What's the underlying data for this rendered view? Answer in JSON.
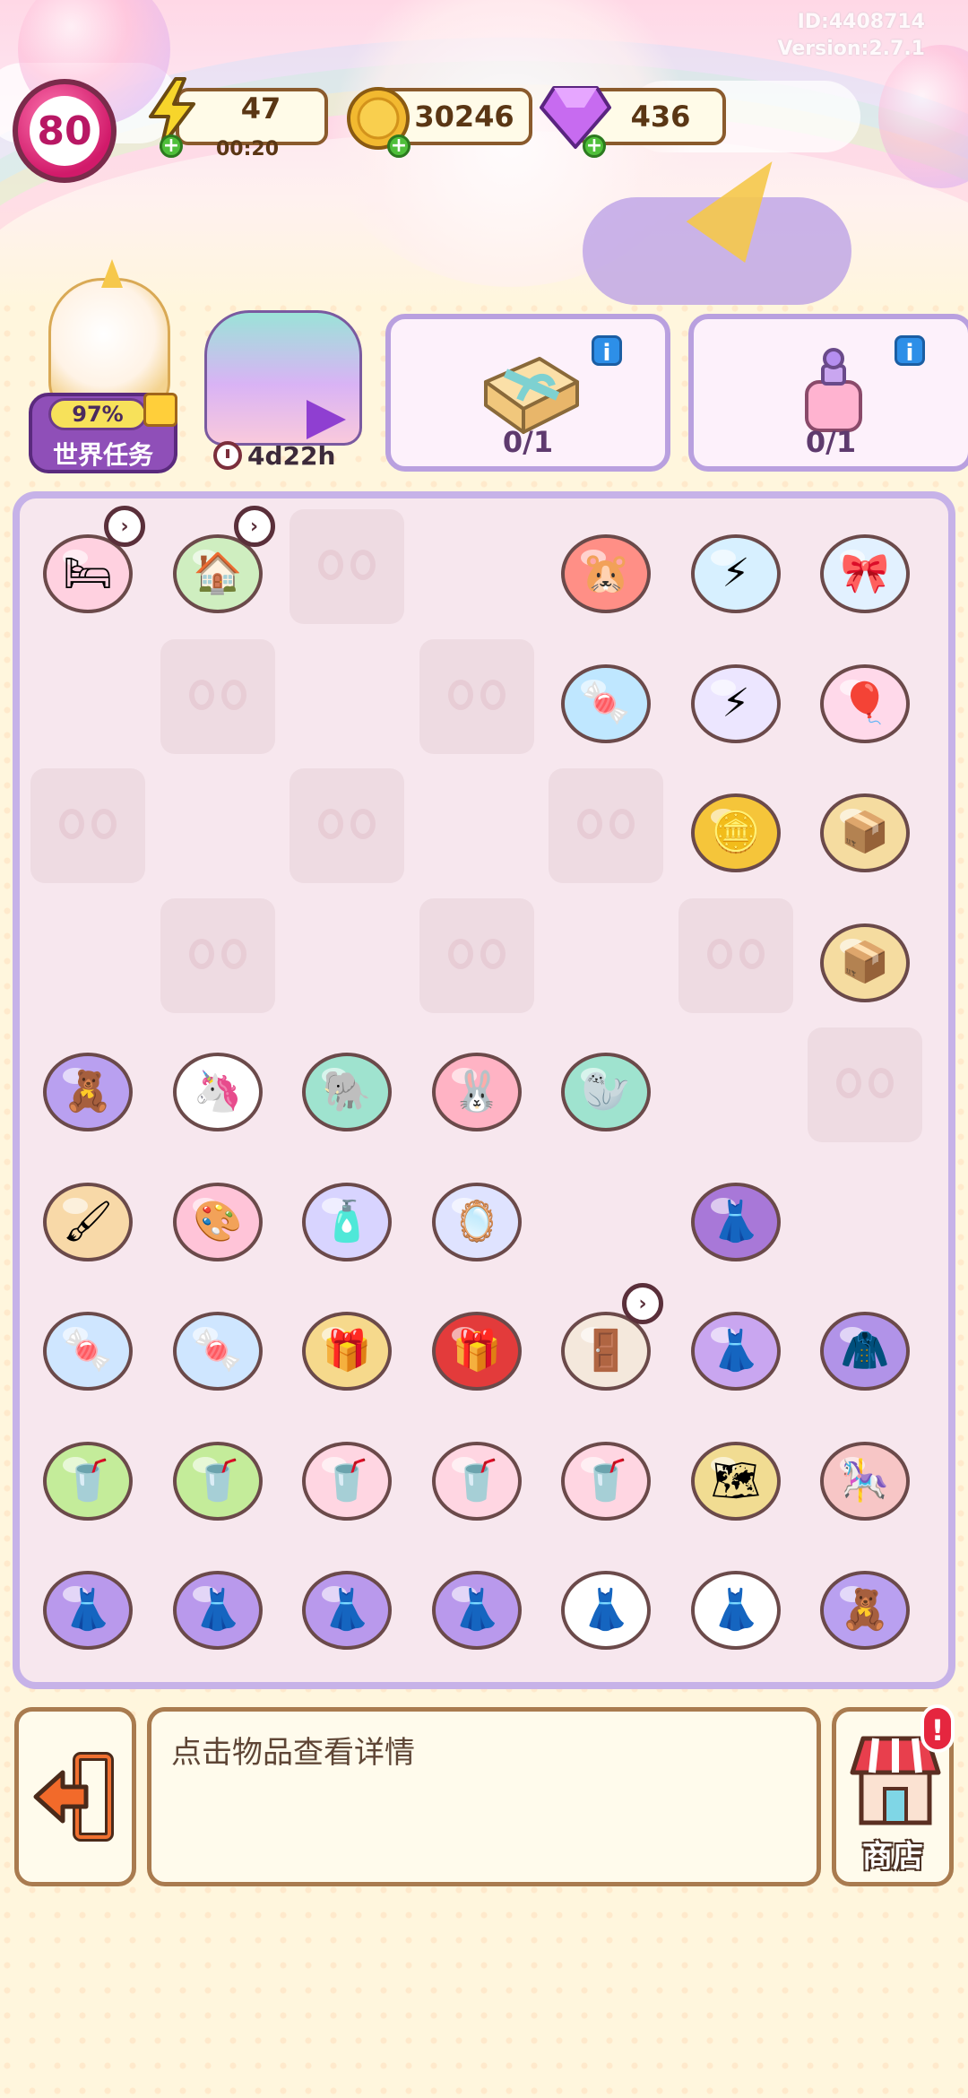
{
  "meta": {
    "id": "ID:4408714",
    "version": "Version:2.7.1"
  },
  "player": {
    "level": "80"
  },
  "resources": {
    "energy": {
      "value": "47",
      "timer": "00:20",
      "icon": "lightning-icon"
    },
    "coins": {
      "value": "30246",
      "icon": "coin-icon"
    },
    "gems": {
      "value": "436",
      "icon": "gem-icon"
    }
  },
  "world_task": {
    "percent": "97%",
    "label": "世界任务"
  },
  "event": {
    "timer": "4d22h"
  },
  "orders": [
    {
      "item": "gift-box-icon",
      "count": "0/1"
    },
    {
      "item": "perfume-bottle-icon",
      "count": "0/1"
    }
  ],
  "board": {
    "columns": 7,
    "rows": 9,
    "cells": [
      {
        "r": 0,
        "c": 0,
        "state": "open",
        "item": "canopy-bed",
        "icon": "🛏",
        "bg": "#ffd1e0",
        "timer": true
      },
      {
        "r": 0,
        "c": 1,
        "state": "open",
        "item": "toy-house",
        "icon": "🏠",
        "bg": "#cfeec0",
        "timer": true
      },
      {
        "r": 0,
        "c": 2,
        "state": "locked"
      },
      {
        "r": 0,
        "c": 3,
        "state": "open",
        "item": "",
        "icon": ""
      },
      {
        "r": 0,
        "c": 4,
        "state": "open",
        "item": "hamster-plush",
        "icon": "🐹",
        "bg": "#ff8f86"
      },
      {
        "r": 0,
        "c": 5,
        "state": "open",
        "item": "energy-jar-small",
        "icon": "⚡",
        "bg": "#d7f0ff"
      },
      {
        "r": 0,
        "c": 6,
        "state": "open",
        "item": "bow-gift-jar",
        "icon": "🎀",
        "bg": "#e2f1ff"
      },
      {
        "r": 1,
        "c": 0,
        "state": "open",
        "item": "",
        "icon": ""
      },
      {
        "r": 1,
        "c": 1,
        "state": "locked"
      },
      {
        "r": 1,
        "c": 2,
        "state": "open",
        "item": "",
        "icon": ""
      },
      {
        "r": 1,
        "c": 3,
        "state": "locked"
      },
      {
        "r": 1,
        "c": 4,
        "state": "open",
        "item": "candy-tray",
        "icon": "🍬",
        "bg": "#bfe7ff"
      },
      {
        "r": 1,
        "c": 5,
        "state": "open",
        "item": "energy-jar-large",
        "icon": "⚡",
        "bg": "#ece6ff"
      },
      {
        "r": 1,
        "c": 6,
        "state": "open",
        "item": "balloon-gift",
        "icon": "🎈",
        "bg": "#ffd9ea"
      },
      {
        "r": 2,
        "c": 0,
        "state": "locked"
      },
      {
        "r": 2,
        "c": 1,
        "state": "open",
        "item": "",
        "icon": ""
      },
      {
        "r": 2,
        "c": 2,
        "state": "locked"
      },
      {
        "r": 2,
        "c": 3,
        "state": "open",
        "item": "",
        "icon": ""
      },
      {
        "r": 2,
        "c": 4,
        "state": "locked"
      },
      {
        "r": 2,
        "c": 5,
        "state": "open",
        "item": "gold-coin",
        "icon": "🪙",
        "bg": "#f5c53a"
      },
      {
        "r": 2,
        "c": 6,
        "state": "open",
        "item": "open-box-large",
        "icon": "📦",
        "bg": "#f5dca0"
      },
      {
        "r": 3,
        "c": 0,
        "state": "open",
        "item": "",
        "icon": ""
      },
      {
        "r": 3,
        "c": 1,
        "state": "locked"
      },
      {
        "r": 3,
        "c": 2,
        "state": "open",
        "item": "",
        "icon": ""
      },
      {
        "r": 3,
        "c": 3,
        "state": "locked"
      },
      {
        "r": 3,
        "c": 4,
        "state": "open",
        "item": "",
        "icon": ""
      },
      {
        "r": 3,
        "c": 5,
        "state": "locked"
      },
      {
        "r": 3,
        "c": 6,
        "state": "open",
        "item": "open-box-small",
        "icon": "📦",
        "bg": "#f5dca0"
      },
      {
        "r": 4,
        "c": 0,
        "state": "open",
        "item": "purple-bear-plush",
        "icon": "🧸",
        "bg": "#b9a0f0"
      },
      {
        "r": 4,
        "c": 1,
        "state": "open",
        "item": "unicorn-plush",
        "icon": "🦄",
        "bg": "#ffffff"
      },
      {
        "r": 4,
        "c": 2,
        "state": "open",
        "item": "elephant-plush",
        "icon": "🐘",
        "bg": "#9fe3cf"
      },
      {
        "r": 4,
        "c": 3,
        "state": "open",
        "item": "bunny-plush",
        "icon": "🐰",
        "bg": "#ffb3c4"
      },
      {
        "r": 4,
        "c": 4,
        "state": "open",
        "item": "seal-plush",
        "icon": "🦭",
        "bg": "#9fe3cf"
      },
      {
        "r": 4,
        "c": 5,
        "state": "open",
        "item": "",
        "icon": ""
      },
      {
        "r": 4,
        "c": 6,
        "state": "locked"
      },
      {
        "r": 5,
        "c": 0,
        "state": "open",
        "item": "makeup-brush",
        "icon": "🖌",
        "bg": "#f8d9a8"
      },
      {
        "r": 5,
        "c": 1,
        "state": "open",
        "item": "eyeshadow-palette",
        "icon": "🎨",
        "bg": "#ffc4d8"
      },
      {
        "r": 5,
        "c": 2,
        "state": "open",
        "item": "skincare-bottles",
        "icon": "🧴",
        "bg": "#d8d4ff"
      },
      {
        "r": 5,
        "c": 3,
        "state": "open",
        "item": "hand-mirror",
        "icon": "🪞",
        "bg": "#dfe3ff"
      },
      {
        "r": 5,
        "c": 4,
        "state": "open",
        "item": "",
        "icon": ""
      },
      {
        "r": 5,
        "c": 5,
        "state": "open",
        "item": "purple-skirt",
        "icon": "👗",
        "bg": "#a878d8"
      },
      {
        "r": 5,
        "c": 6,
        "state": "open",
        "item": "",
        "icon": ""
      },
      {
        "r": 6,
        "c": 0,
        "state": "open",
        "item": "candy-jar",
        "icon": "🍬",
        "bg": "#cfe6ff"
      },
      {
        "r": 6,
        "c": 1,
        "state": "open",
        "item": "candy-jar",
        "icon": "🍬",
        "bg": "#cfe6ff"
      },
      {
        "r": 6,
        "c": 2,
        "state": "open",
        "item": "gift-box",
        "icon": "🎁",
        "bg": "#f6d98c"
      },
      {
        "r": 6,
        "c": 3,
        "state": "open",
        "item": "red-gift-box",
        "icon": "🎁",
        "bg": "#e33b3b"
      },
      {
        "r": 6,
        "c": 4,
        "state": "open",
        "item": "wardrobe",
        "icon": "🚪",
        "bg": "#f4e8dc",
        "timer": true
      },
      {
        "r": 6,
        "c": 5,
        "state": "open",
        "item": "purple-dress",
        "icon": "👗",
        "bg": "#c9a6f0"
      },
      {
        "r": 6,
        "c": 6,
        "state": "open",
        "item": "purple-jacket",
        "icon": "🧥",
        "bg": "#b193e8"
      },
      {
        "r": 7,
        "c": 0,
        "state": "open",
        "item": "matcha-drink",
        "icon": "🥤",
        "bg": "#c4ec9a"
      },
      {
        "r": 7,
        "c": 1,
        "state": "open",
        "item": "matcha-drink",
        "icon": "🥤",
        "bg": "#c4ec9a"
      },
      {
        "r": 7,
        "c": 2,
        "state": "open",
        "item": "strawberry-drink",
        "icon": "🥤",
        "bg": "#ffd6e2"
      },
      {
        "r": 7,
        "c": 3,
        "state": "open",
        "item": "strawberry-drink",
        "icon": "🥤",
        "bg": "#ffd6e2"
      },
      {
        "r": 7,
        "c": 4,
        "state": "open",
        "item": "strawberry-drink",
        "icon": "🥤",
        "bg": "#ffd6e2"
      },
      {
        "r": 7,
        "c": 5,
        "state": "open",
        "item": "treasure-map",
        "icon": "🗺",
        "bg": "#f1dc92"
      },
      {
        "r": 7,
        "c": 6,
        "state": "open",
        "item": "swing-ride",
        "icon": "🎠",
        "bg": "#f7c6c6"
      },
      {
        "r": 8,
        "c": 0,
        "state": "open",
        "item": "purple-ball-gown",
        "icon": "👗",
        "bg": "#b999ec"
      },
      {
        "r": 8,
        "c": 1,
        "state": "open",
        "item": "purple-ball-gown",
        "icon": "👗",
        "bg": "#b999ec"
      },
      {
        "r": 8,
        "c": 2,
        "state": "open",
        "item": "purple-ball-gown",
        "icon": "👗",
        "bg": "#b999ec"
      },
      {
        "r": 8,
        "c": 3,
        "state": "open",
        "item": "purple-ball-gown",
        "icon": "👗",
        "bg": "#b999ec"
      },
      {
        "r": 8,
        "c": 4,
        "state": "open",
        "item": "white-dress",
        "icon": "👗",
        "bg": "#ffffff"
      },
      {
        "r": 8,
        "c": 5,
        "state": "open",
        "item": "white-dress",
        "icon": "👗",
        "bg": "#ffffff"
      },
      {
        "r": 8,
        "c": 6,
        "state": "open",
        "item": "purple-bear-plush",
        "icon": "🧸",
        "bg": "#b9a0f0"
      }
    ]
  },
  "bottom": {
    "hint": "点击物品查看详情",
    "shop_label": "商店",
    "alert": "!"
  },
  "colors": {
    "board_border": "#c6b2e8",
    "locked_cell": "#eedbe2",
    "pill_border": "#8a5a2c"
  }
}
